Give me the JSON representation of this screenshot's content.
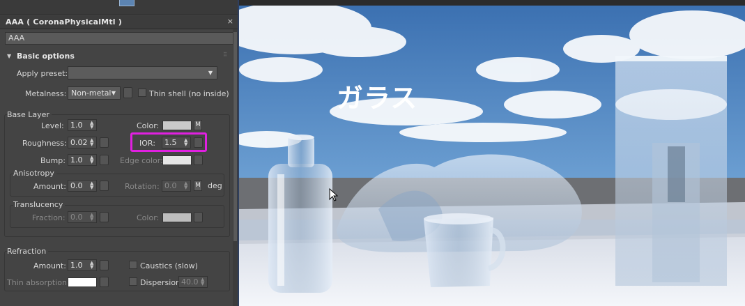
{
  "panel": {
    "title": "AAA  ( CoronaPhysicalMtl )",
    "close_glyph": "×",
    "material_name": "AAA"
  },
  "basic_options": {
    "header": "Basic options",
    "apply_preset_label": "Apply preset:",
    "apply_preset_value": "",
    "metalness_label": "Metalness:",
    "metalness_value": "Non-metal",
    "thin_shell_label": "Thin shell (no inside)"
  },
  "base_layer": {
    "label": "Base Layer",
    "level_label": "Level:",
    "level_value": "1.0",
    "color_label": "Color:",
    "color_hex": "#c9c9c9",
    "roughness_label": "Roughness:",
    "roughness_value": "0.02",
    "ior_label": "IOR:",
    "ior_value": "1.5",
    "bump_label": "Bump:",
    "bump_value": "1.0",
    "edge_color_label": "Edge color:",
    "edge_color_hex": "#e6e6e6",
    "m_button": "M"
  },
  "anisotropy": {
    "label": "Anisotropy",
    "amount_label": "Amount:",
    "amount_value": "0.0",
    "rotation_label": "Rotation:",
    "rotation_value": "0.0",
    "rotation_unit": "deg",
    "m_button": "M"
  },
  "translucency": {
    "label": "Translucency",
    "fraction_label": "Fraction:",
    "fraction_value": "0.0",
    "color_label": "Color:",
    "color_hex": "#bdbdbd"
  },
  "refraction": {
    "label": "Refraction",
    "amount_label": "Amount:",
    "amount_value": "1.0",
    "caustics_label": "Caustics (slow)",
    "thin_absorption_label": "Thin absorption:",
    "thin_absorption_hex": "#ffffff",
    "dispersion_label": "Dispersion",
    "dispersion_value": "40.0"
  },
  "viewport": {
    "overlay_text": "ガラス"
  },
  "colors": {
    "highlight": "#e020e0",
    "sky": "#3f78b5"
  }
}
